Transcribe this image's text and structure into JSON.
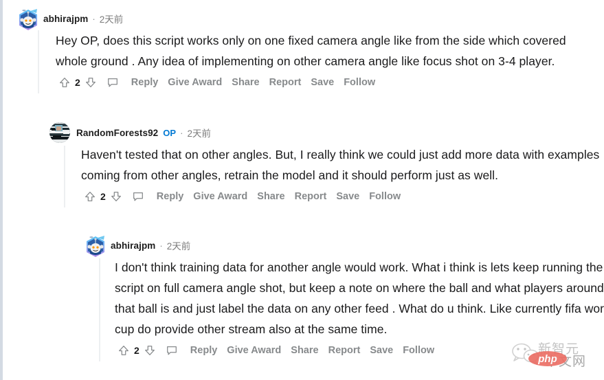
{
  "page": {
    "background_color": "#ffffff",
    "rail_color": "#d3dae3",
    "thread_line_color": "#edeff1",
    "accent_color": "#0079d3",
    "text_color": "#1a1a1b",
    "muted_color": "#878a8c"
  },
  "actions_labels": {
    "reply": "Reply",
    "give_award": "Give Award",
    "share": "Share",
    "report": "Report",
    "save": "Save",
    "follow": "Follow"
  },
  "comments": [
    {
      "id": "c1",
      "depth": 1,
      "author": "abhirajpm",
      "is_op": false,
      "op_label": "",
      "separator": "·",
      "timestamp": "2天前",
      "avatar_type": "snoo-avatar",
      "body": "Hey OP, does this script works only on one fixed camera angle like from the side which covered whole ground . Any idea of implementing on other camera angle like focus shot on 3-4 player.",
      "score": "2"
    },
    {
      "id": "c2",
      "depth": 2,
      "author": "RandomForests92",
      "is_op": true,
      "op_label": "OP",
      "separator": "·",
      "timestamp": "2天前",
      "avatar_type": "photo-avatar",
      "body": "Haven't tested that on other angles. But, I really think we could just add more data with examples coming from other angles, retrain the model and it should perform just as well.",
      "score": "2"
    },
    {
      "id": "c3",
      "depth": 3,
      "author": "abhirajpm",
      "is_op": false,
      "op_label": "",
      "separator": "·",
      "timestamp": "2天前",
      "avatar_type": "snoo-avatar",
      "body": "I don't think training data for another angle would work. What i think is lets keep running the script on full camera angle shot, but keep a note on where the ball and what players around that ball is and just label the data on any other feed . What do u think. Like currently fifa world cup do provide other stream also at the same time.",
      "score": "2"
    }
  ],
  "watermark": {
    "brand_line1": "新智元",
    "brand_line2": "中文网",
    "php_label": "php",
    "php_color": "#e8564b"
  }
}
